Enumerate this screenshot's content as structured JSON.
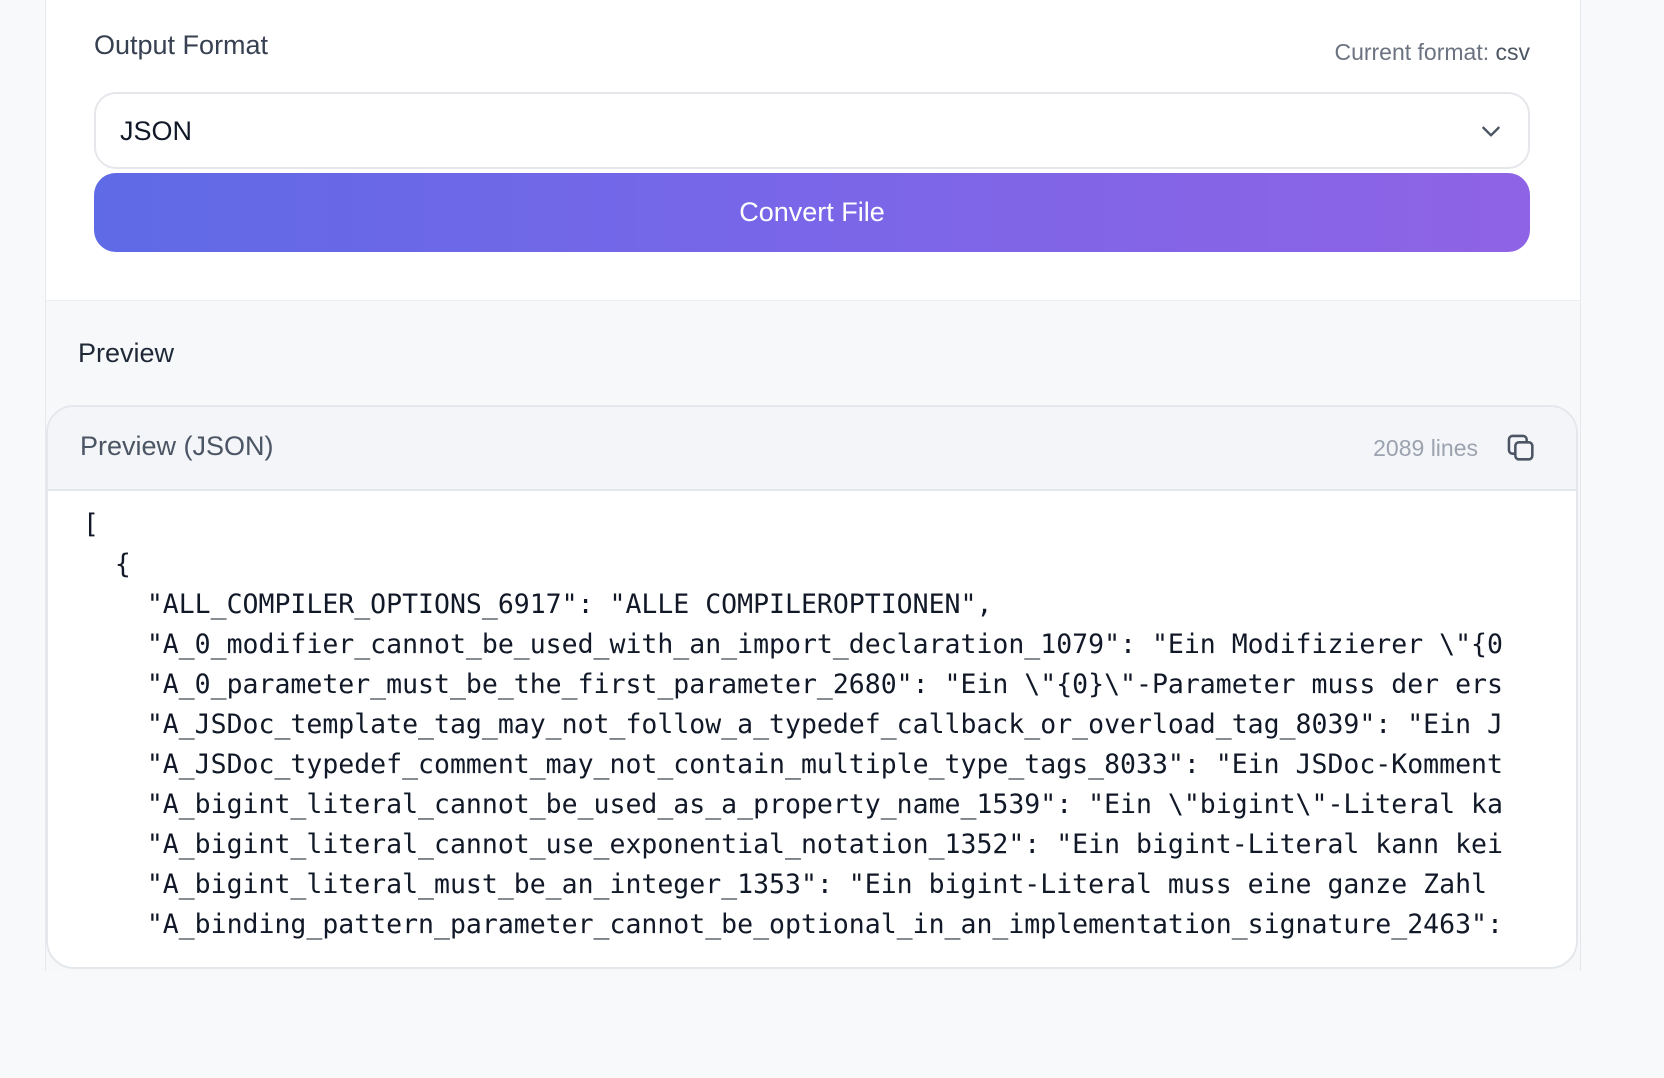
{
  "form": {
    "output_label": "Output Format",
    "current_format_prefix": "Current format:",
    "current_format_value": "csv",
    "selected_format": "JSON",
    "convert_label": "Convert File"
  },
  "preview": {
    "section_title": "Preview",
    "panel_title": "Preview (JSON)",
    "line_count": "2089 lines",
    "code_lines": [
      "[",
      "  {",
      "    \"ALL_COMPILER_OPTIONS_6917\": \"ALLE COMPILEROPTIONEN\",",
      "    \"A_0_modifier_cannot_be_used_with_an_import_declaration_1079\": \"Ein Modifizierer \\\"{0",
      "    \"A_0_parameter_must_be_the_first_parameter_2680\": \"Ein \\\"{0}\\\"-Parameter muss der ers",
      "    \"A_JSDoc_template_tag_may_not_follow_a_typedef_callback_or_overload_tag_8039\": \"Ein J",
      "    \"A_JSDoc_typedef_comment_may_not_contain_multiple_type_tags_8033\": \"Ein JSDoc-Komment",
      "    \"A_bigint_literal_cannot_be_used_as_a_property_name_1539\": \"Ein \\\"bigint\\\"-Literal ka",
      "    \"A_bigint_literal_cannot_use_exponential_notation_1352\": \"Ein bigint-Literal kann kei",
      "    \"A_bigint_literal_must_be_an_integer_1353\": \"Ein bigint-Literal muss eine ganze Zahl ",
      "    \"A_binding_pattern_parameter_cannot_be_optional_in_an_implementation_signature_2463\":"
    ]
  },
  "icons": {
    "chevron": "chevron-down-icon",
    "copy": "copy-icon"
  }
}
